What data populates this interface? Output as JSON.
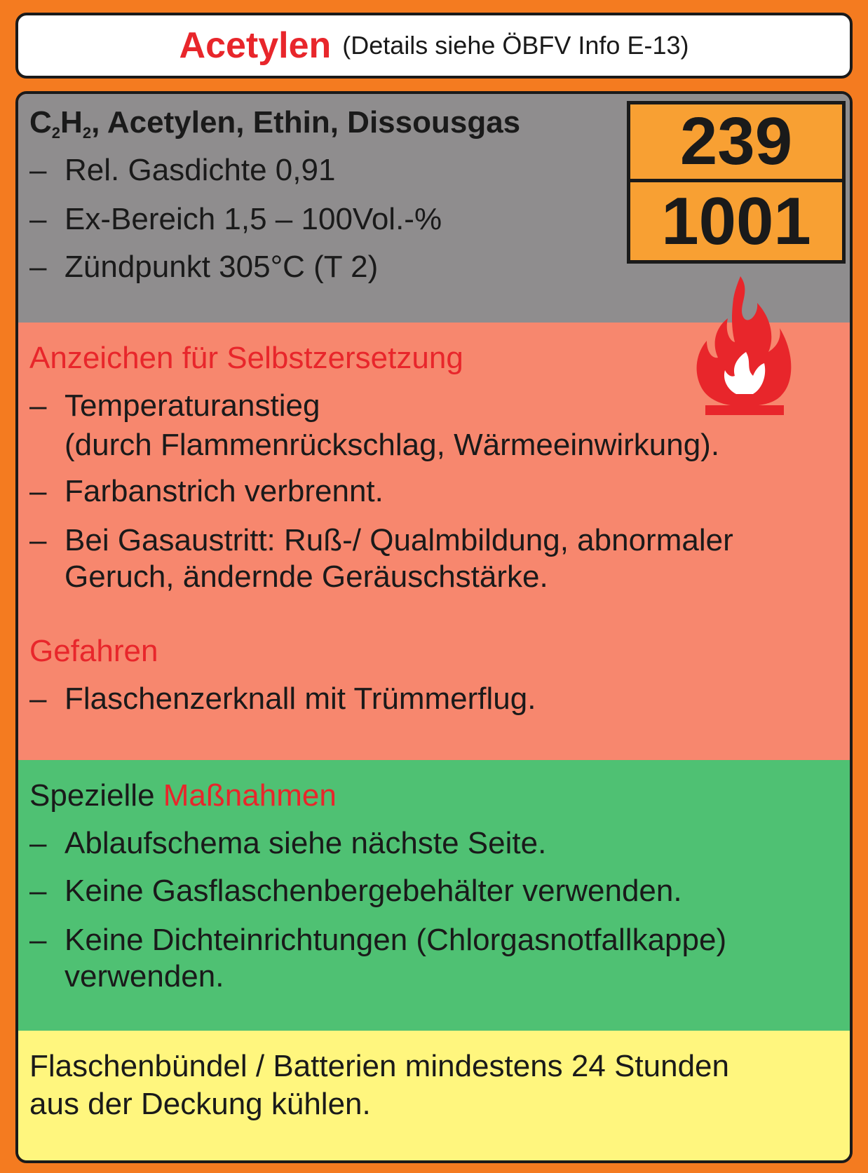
{
  "title": {
    "name": "Acetylen",
    "details": "(Details siehe ÖBFV Info E-13)"
  },
  "substance": {
    "c": "C",
    "sub1": "2",
    "h": "H",
    "sub2": "2",
    "names": ", Acetylen, Ethin, Dissousgas",
    "props": [
      "Rel. Gasdichte 0,91",
      "Ex-Bereich 1,5 – 100Vol.-%",
      "Zündpunkt 305°C (T 2)"
    ]
  },
  "un_plate": {
    "hazard_number": "239",
    "un_number": "1001"
  },
  "signs": {
    "heading": "Anzeichen für Selbstzersetzung",
    "items": [
      {
        "line1": "Temperaturanstieg",
        "line2": "(durch Flammenrückschlag, Wärmeeinwirkung)."
      },
      {
        "line1": "Farbanstrich verbrennt."
      },
      {
        "line1": "Bei Gasaustritt: Ruß-/ Qualmbildung, abnormaler",
        "line2": "Geruch, ändernde Geräuschstärke."
      }
    ]
  },
  "dangers": {
    "heading": "Gefahren",
    "items": [
      "Flaschenzerknall mit Trümmerflug."
    ]
  },
  "measures": {
    "heading_part1": "Spezielle ",
    "heading_part2": "Maßnahmen",
    "items": [
      {
        "line1": "Ablaufschema siehe nächste Seite."
      },
      {
        "line1": "Keine Gasflaschenbergebehälter verwenden."
      },
      {
        "line1": "Keine Dichteinrichtungen (Chlorgasnotfallkappe)",
        "line2": "verwenden."
      }
    ]
  },
  "note": {
    "line1": "Flaschenbündel / Batterien mindestens 24 Stunden",
    "line2": "aus der Deckung kühlen."
  },
  "bullet": "–",
  "icons": {
    "flame": "flammable-flame-icon"
  },
  "colors": {
    "frame": "#f47b20",
    "title_red": "#e8262b",
    "grey": "#8f8d8e",
    "salmon": "#f7876e",
    "green": "#4fc173",
    "yellow": "#fff67e",
    "plate_orange": "#f8a033"
  }
}
